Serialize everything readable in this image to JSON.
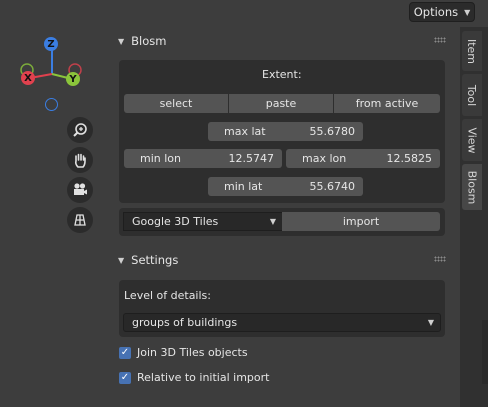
{
  "header": {
    "options_label": "Options"
  },
  "gizmo": {
    "z_label": "Z",
    "x_label": "X",
    "y_label": "Y",
    "colors": {
      "z": "#3b7ee2",
      "x": "#e0414e",
      "y": "#8bc53b"
    }
  },
  "nav_icons": [
    "zoom-icon",
    "hand-pan-icon",
    "camera-icon",
    "grid-view-icon"
  ],
  "blosm_panel": {
    "title": "Blosm",
    "extent_label": "Extent:",
    "buttons": {
      "select": "select",
      "paste": "paste",
      "from_active": "from active"
    },
    "max_lat": {
      "label": "max lat",
      "value": "55.6780"
    },
    "min_lon": {
      "label": "min lon",
      "value": "12.5747"
    },
    "max_lon": {
      "label": "max lon",
      "value": "12.5825"
    },
    "min_lat": {
      "label": "min lat",
      "value": "55.6740"
    },
    "source_select": "Google 3D Tiles",
    "import_label": "import"
  },
  "settings_panel": {
    "title": "Settings",
    "lod_label": "Level of details:",
    "lod_value": "groups of buildings",
    "join_label": "Join 3D Tiles objects",
    "join_checked": true,
    "relative_label": "Relative to initial import",
    "relative_checked": true
  },
  "tabs": [
    "Item",
    "Tool",
    "View",
    "Blosm"
  ],
  "active_tab": "Blosm",
  "accent": "#4772b3"
}
